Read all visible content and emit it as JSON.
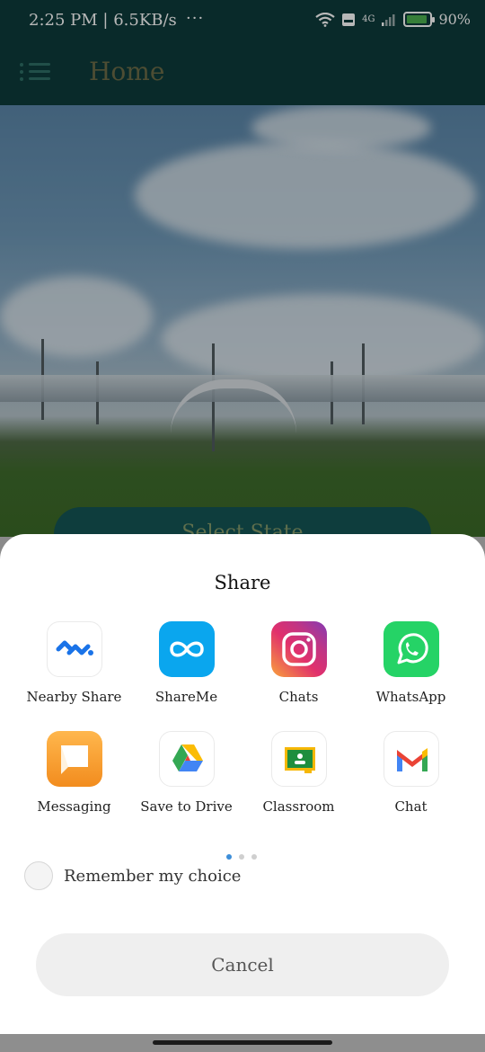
{
  "status_bar": {
    "time": "2:25 PM | 6.5KB/s",
    "dots": "···",
    "network": "4G",
    "battery": "90%",
    "battery_level": 0.9
  },
  "app_bar": {
    "title": "Home"
  },
  "main": {
    "select_button": "Select State"
  },
  "share_sheet": {
    "title": "Share",
    "apps": [
      {
        "label": "Nearby Share",
        "icon": "nearby-share-icon"
      },
      {
        "label": "ShareMe",
        "icon": "shareme-icon"
      },
      {
        "label": "Chats",
        "icon": "instagram-icon"
      },
      {
        "label": "WhatsApp",
        "icon": "whatsapp-icon"
      },
      {
        "label": "Messaging",
        "icon": "messaging-icon"
      },
      {
        "label": "Save to Drive",
        "icon": "google-drive-icon"
      },
      {
        "label": "Classroom",
        "icon": "google-classroom-icon"
      },
      {
        "label": "Chat",
        "icon": "gmail-icon"
      }
    ],
    "page_indicator": {
      "pages": 3,
      "current": 1
    },
    "remember_label": "Remember my choice",
    "cancel_label": "Cancel"
  },
  "colors": {
    "app_bar": "#0d3b3b",
    "sheet": "#ffffff",
    "accent": "#3d8ed9"
  }
}
